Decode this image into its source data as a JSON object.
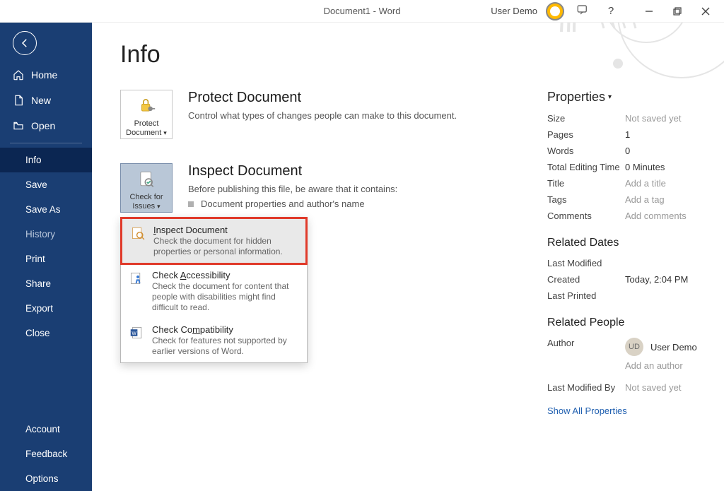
{
  "titlebar": {
    "title": "Document1  -  Word",
    "user": "User Demo"
  },
  "sidebar": {
    "top": [
      {
        "label": "Home",
        "icon": "home-icon"
      },
      {
        "label": "New",
        "icon": "new-doc-icon"
      },
      {
        "label": "Open",
        "icon": "folder-open-icon"
      }
    ],
    "middle": [
      {
        "label": "Info",
        "active": true
      },
      {
        "label": "Save"
      },
      {
        "label": "Save As"
      },
      {
        "label": "History",
        "muted": true
      },
      {
        "label": "Print"
      },
      {
        "label": "Share"
      },
      {
        "label": "Export"
      },
      {
        "label": "Close"
      }
    ],
    "bottom": [
      {
        "label": "Account"
      },
      {
        "label": "Feedback"
      },
      {
        "label": "Options"
      }
    ]
  },
  "page": {
    "title": "Info",
    "protect": {
      "tile": "Protect Document",
      "heading": "Protect Document",
      "desc": "Control what types of changes people can make to this document."
    },
    "inspect": {
      "tile": "Check for Issues",
      "heading": "Inspect Document",
      "desc": "Before publishing this file, be aware that it contains:",
      "bullet": "Document properties and author's name",
      "menu": [
        {
          "title_pre": "",
          "title_ul": "I",
          "title_post": "nspect Document",
          "sub": "Check the document for hidden properties or personal information.",
          "highlight": true,
          "icon": "inspect-doc-icon"
        },
        {
          "title_pre": "Check ",
          "title_ul": "A",
          "title_post": "ccessibility",
          "sub": "Check the document for content that people with disabilities might find difficult to read.",
          "highlight": false,
          "icon": "accessibility-icon"
        },
        {
          "title_pre": "Check Co",
          "title_ul": "m",
          "title_post": "patibility",
          "sub": "Check for features not supported by earlier versions of Word.",
          "highlight": false,
          "icon": "word-doc-icon"
        }
      ]
    },
    "properties": {
      "header": "Properties",
      "rows": [
        {
          "label": "Size",
          "value": "Not saved yet",
          "muted": true
        },
        {
          "label": "Pages",
          "value": "1"
        },
        {
          "label": "Words",
          "value": "0"
        },
        {
          "label": "Total Editing Time",
          "value": "0 Minutes"
        },
        {
          "label": "Title",
          "value": "Add a title",
          "muted": true
        },
        {
          "label": "Tags",
          "value": "Add a tag",
          "muted": true
        },
        {
          "label": "Comments",
          "value": "Add comments",
          "muted": true
        }
      ],
      "relatedDatesHeader": "Related Dates",
      "relatedDates": [
        {
          "label": "Last Modified",
          "value": ""
        },
        {
          "label": "Created",
          "value": "Today, 2:04 PM"
        },
        {
          "label": "Last Printed",
          "value": ""
        }
      ],
      "relatedPeopleHeader": "Related People",
      "authorLabel": "Author",
      "authorInitials": "UD",
      "authorName": "User Demo",
      "addAuthor": "Add an author",
      "lastModifiedByLabel": "Last Modified By",
      "lastModifiedByValue": "Not saved yet",
      "showAll": "Show All Properties"
    }
  }
}
